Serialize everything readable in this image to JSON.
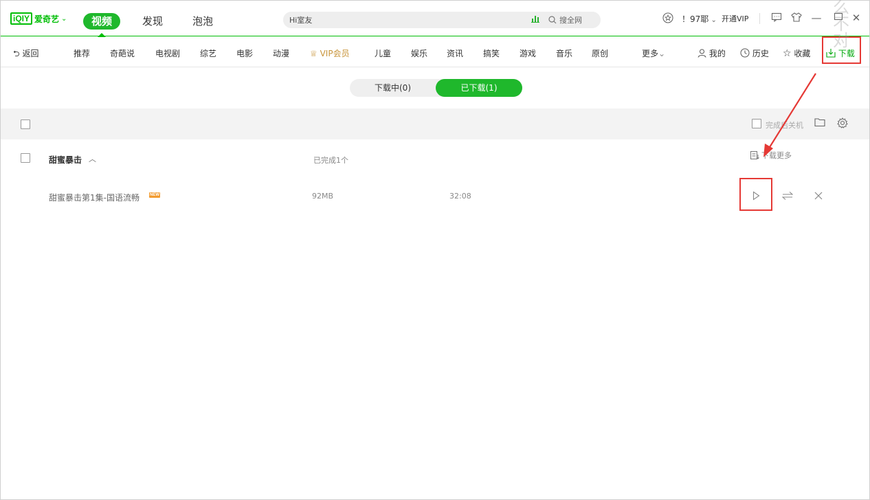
{
  "logo": {
    "mark": "iQIY",
    "text": "爱奇艺"
  },
  "top_tabs": [
    {
      "label": "视频",
      "active": true
    },
    {
      "label": "发现"
    },
    {
      "label": "泡泡"
    }
  ],
  "search": {
    "placeholder": "Hi室友",
    "button": "搜全网"
  },
  "user": {
    "name": "！97耶",
    "vip": "开通VIP"
  },
  "nav": {
    "back": "返回",
    "items": [
      "推荐",
      "奇葩说",
      "电视剧",
      "综艺",
      "电影",
      "动漫",
      "VIP会员",
      "儿童",
      "娱乐",
      "资讯",
      "搞笑",
      "游戏",
      "音乐",
      "原创"
    ],
    "more": "更多",
    "mine": "我的",
    "history": "历史",
    "favorites": "收藏",
    "download": "下载"
  },
  "segment": {
    "downloading": "下载中(0)",
    "downloaded": "已下载(1)"
  },
  "toolbar": {
    "shutdown_label": "完成后关机"
  },
  "group": {
    "title": "甜蜜暴击",
    "status": "已完成1个",
    "more": "下载更多"
  },
  "rows": [
    {
      "name": "甜蜜暴击第1集-国语流畅",
      "badge": "NEW",
      "size": "92MB",
      "duration": "32:08"
    }
  ],
  "watermark": "么不对",
  "colors": {
    "accent": "#00be06",
    "annotation": "#e53935",
    "vip": "#c8943a"
  },
  "icons": {
    "search": "search-icon",
    "chart": "hot-chart-icon",
    "coin": "coin-icon",
    "message": "message-icon",
    "skin": "skin-icon",
    "minimize": "minimize-icon",
    "maximize": "maximize-icon",
    "close": "close-icon",
    "folder": "folder-icon",
    "settings": "gear-icon",
    "play": "play-icon",
    "transfer": "transfer-icon",
    "delete": "delete-icon"
  }
}
